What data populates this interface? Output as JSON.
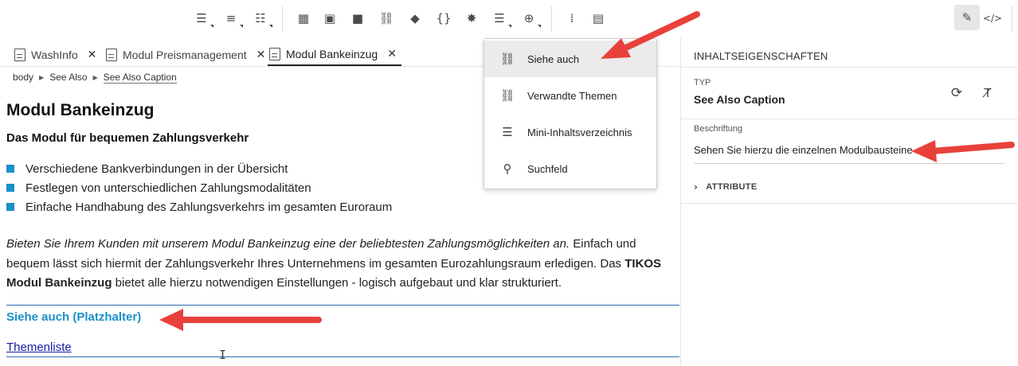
{
  "toolbar": {
    "buttons": [
      {
        "icon": "bulleted-list-icon",
        "glyph": "☰"
      },
      {
        "icon": "numbered-list-icon",
        "glyph": "≡"
      },
      {
        "icon": "indent-list-icon",
        "glyph": "☷"
      },
      {
        "icon": "insert-table-icon",
        "glyph": "▦"
      },
      {
        "icon": "image-icon",
        "glyph": "▣"
      },
      {
        "icon": "video-icon",
        "glyph": "■"
      },
      {
        "icon": "link-icon",
        "glyph": "⛓"
      },
      {
        "icon": "eraser-icon",
        "glyph": "◆"
      },
      {
        "icon": "code-braces-icon",
        "glyph": "{}"
      },
      {
        "icon": "star-burst-icon",
        "glyph": "✸"
      },
      {
        "icon": "layout-icon",
        "glyph": "☰"
      },
      {
        "icon": "add-circle-icon",
        "glyph": "⊕"
      },
      {
        "icon": "outline-list-icon",
        "glyph": "⁞"
      },
      {
        "icon": "document-lines-icon",
        "glyph": "▤"
      }
    ],
    "right_buttons": [
      {
        "icon": "pencil-icon",
        "glyph": "✎"
      },
      {
        "icon": "code-view-icon",
        "glyph": "</>"
      }
    ]
  },
  "tabs": [
    {
      "label": "WashInfo",
      "active": false
    },
    {
      "label": "Modul Preismanagement",
      "active": false
    },
    {
      "label": "Modul Bankeinzug",
      "active": true
    }
  ],
  "breadcrumb": [
    "body",
    "See Also",
    "See Also Caption"
  ],
  "document": {
    "title": "Modul Bankeinzug",
    "subtitle": "Das Modul für bequemen Zahlungsverkehr",
    "bullets": [
      "Verschiedene Bankverbindungen in der Übersicht",
      "Festlegen von unterschiedlichen Zahlungsmodalitäten",
      "Einfache Handhabung des Zahlungsverkehrs im gesamten Euroraum"
    ],
    "paragraph_italic": "Bieten Sie Ihrem Kunden mit unserem Modul Bankeinzug eine der beliebtesten Zahlungsmöglichkeiten an.",
    "paragraph_text1": " Einfach und bequem lässt sich hiermit der Zahlungsverkehr Ihres Unternehmens im gesamten Eurozahlungsraum erledigen. Das ",
    "paragraph_bold": "TIKOS Modul Bankeinzug",
    "paragraph_text2": " bietet alle hierzu notwendigen Einstellungen - logisch aufgebaut und klar strukturiert.",
    "see_also_title": "Siehe auch (Platzhalter)",
    "see_also_link": "Themenliste"
  },
  "dropdown": {
    "items": [
      {
        "label": "Siehe auch",
        "icon": "see-also-link-icon",
        "glyph": "⛓",
        "highlighted": true
      },
      {
        "label": "Verwandte Themen",
        "icon": "related-topics-icon",
        "glyph": "⛓",
        "highlighted": false
      },
      {
        "label": "Mini-Inhaltsverzeichnis",
        "icon": "mini-toc-icon",
        "glyph": "☰",
        "highlighted": false
      },
      {
        "label": "Suchfeld",
        "icon": "search-icon",
        "glyph": "⚲",
        "highlighted": false
      }
    ]
  },
  "panel": {
    "header": "INHALTSEIGENSCHAFTEN",
    "type_label": "TYP",
    "type_value": "See Also Caption",
    "caption_label": "Beschriftung",
    "caption_value": "Sehen Sie hierzu die einzelnen Modulbausteine",
    "attribute_label": "ATTRIBUTE"
  },
  "colors": {
    "accent_blue": "#1a90c8",
    "link_blue": "#1a1aa6",
    "border_blue": "#2b6bb2",
    "arrow_red": "#e8413c"
  }
}
